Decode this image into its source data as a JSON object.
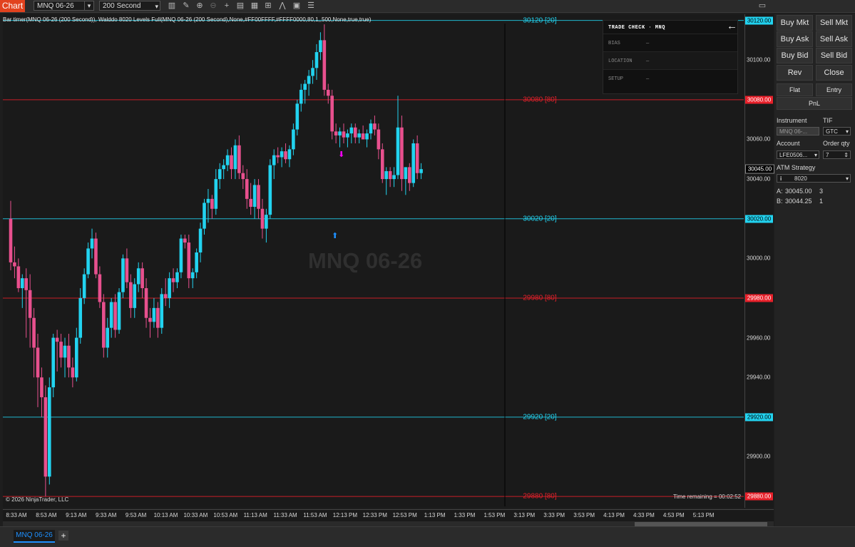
{
  "toolbar": {
    "chart_label": "Chart",
    "instrument": "MNQ 06-26",
    "period": "200 Second",
    "icons": [
      "bar-type-icon",
      "draw-pencil-icon",
      "zoom-in-icon",
      "zoom-out-icon",
      "crosshair-icon",
      "data-box-icon",
      "properties-icon",
      "strategies-icon",
      "indicators-icon",
      "templates-icon",
      "chart-trader-icon"
    ]
  },
  "chart": {
    "indicator_text": "Bar timer(MNQ 06-26 (200 Second)), Walddo 8020 Levels Full(MNQ 06-26 (200 Second),None,#FF00FFFF,#FFFF0000,80,1,,500,None,true,true)",
    "watermark": "MNQ 06-26",
    "copyright": "© 2026 NinjaTrader, LLC",
    "time_remaining": "Time remaining = 00:02:52",
    "up_color": "#22d3f0",
    "down_color": "#e8508e"
  },
  "trade_check": {
    "title": "TRADE CHECK  ·  MNQ",
    "rows": [
      {
        "label": "BIAS",
        "value": "—"
      },
      {
        "label": "LOCATION",
        "value": "—"
      },
      {
        "label": "SETUP",
        "value": "—"
      }
    ]
  },
  "levels": [
    {
      "price": 30120,
      "text": "30120 [20]",
      "badge": "30120.00",
      "color": "#22d3f0"
    },
    {
      "price": 30080,
      "text": "30080 [80]",
      "badge": "30080.00",
      "color": "#e8202a"
    },
    {
      "price": 30020,
      "text": "30020 [20]",
      "badge": "30020.00",
      "color": "#22d3f0"
    },
    {
      "price": 29980,
      "text": "29980 [80]",
      "badge": "29980.00",
      "color": "#e8202a"
    },
    {
      "price": 29920,
      "text": "29920 [20]",
      "badge": "29920.00",
      "color": "#22d3f0"
    },
    {
      "price": 29880,
      "text": "29880 [80]",
      "badge": "29880.00",
      "color": "#e8202a"
    }
  ],
  "last_price_badge": "30045.00",
  "price_ticks": [
    "30100.00",
    "30060.00",
    "30040.00",
    "30000.00",
    "29960.00",
    "29940.00",
    "29900.00"
  ],
  "chart_data": {
    "type": "candlestick",
    "x_ticks": [
      "8:33 AM",
      "8:53 AM",
      "9:13 AM",
      "9:33 AM",
      "9:53 AM",
      "10:13 AM",
      "10:33 AM",
      "10:53 AM",
      "11:13 AM",
      "11:33 AM",
      "11:53 AM",
      "12:13 PM",
      "12:33 PM",
      "12:53 PM",
      "1:13 PM",
      "1:33 PM",
      "1:53 PM",
      "3:13 PM",
      "3:33 PM",
      "3:53 PM",
      "4:13 PM",
      "4:33 PM",
      "4:53 PM",
      "5:13 PM"
    ],
    "ylim": [
      29875,
      30122
    ],
    "y_ticks": [
      30100,
      30060,
      30040,
      30000,
      29960,
      29940,
      29900
    ],
    "last_price": 30045,
    "candles": [
      {
        "o": 30020,
        "h": 30029,
        "l": 29994,
        "c": 29998
      },
      {
        "o": 29998,
        "h": 30006,
        "l": 29990,
        "c": 29996
      },
      {
        "o": 29996,
        "h": 30000,
        "l": 29983,
        "c": 29985
      },
      {
        "o": 29985,
        "h": 29992,
        "l": 29975,
        "c": 29990
      },
      {
        "o": 29990,
        "h": 29995,
        "l": 29960,
        "c": 29984
      },
      {
        "o": 29984,
        "h": 29992,
        "l": 29955,
        "c": 29970
      },
      {
        "o": 29970,
        "h": 29975,
        "l": 29940,
        "c": 29955
      },
      {
        "o": 29955,
        "h": 29962,
        "l": 29925,
        "c": 29940
      },
      {
        "o": 29940,
        "h": 29945,
        "l": 29920,
        "c": 29930
      },
      {
        "o": 29930,
        "h": 29936,
        "l": 29880,
        "c": 29890
      },
      {
        "o": 29890,
        "h": 29940,
        "l": 29886,
        "c": 29935
      },
      {
        "o": 29935,
        "h": 29962,
        "l": 29930,
        "c": 29960
      },
      {
        "o": 29960,
        "h": 29964,
        "l": 29943,
        "c": 29958
      },
      {
        "o": 29958,
        "h": 29962,
        "l": 29945,
        "c": 29950
      },
      {
        "o": 29950,
        "h": 29960,
        "l": 29940,
        "c": 29956
      },
      {
        "o": 29956,
        "h": 29962,
        "l": 29940,
        "c": 29945
      },
      {
        "o": 29945,
        "h": 29950,
        "l": 29935,
        "c": 29940
      },
      {
        "o": 29940,
        "h": 29965,
        "l": 29938,
        "c": 29960
      },
      {
        "o": 29960,
        "h": 29985,
        "l": 29957,
        "c": 29980
      },
      {
        "o": 29980,
        "h": 29995,
        "l": 29977,
        "c": 29992
      },
      {
        "o": 29992,
        "h": 30008,
        "l": 29990,
        "c": 30005
      },
      {
        "o": 30005,
        "h": 30015,
        "l": 30000,
        "c": 30010
      },
      {
        "o": 30010,
        "h": 30013,
        "l": 29990,
        "c": 29992
      },
      {
        "o": 29992,
        "h": 29996,
        "l": 29975,
        "c": 29978
      },
      {
        "o": 29978,
        "h": 29982,
        "l": 29950,
        "c": 29955
      },
      {
        "o": 29955,
        "h": 29970,
        "l": 29950,
        "c": 29965
      },
      {
        "o": 29965,
        "h": 29980,
        "l": 29960,
        "c": 29978
      },
      {
        "o": 29978,
        "h": 29982,
        "l": 29960,
        "c": 29964
      },
      {
        "o": 29964,
        "h": 29985,
        "l": 29962,
        "c": 29983
      },
      {
        "o": 29983,
        "h": 30002,
        "l": 29980,
        "c": 30000
      },
      {
        "o": 30000,
        "h": 30005,
        "l": 29985,
        "c": 29988
      },
      {
        "o": 29988,
        "h": 29992,
        "l": 29970,
        "c": 29975
      },
      {
        "o": 29975,
        "h": 29990,
        "l": 29970,
        "c": 29987
      },
      {
        "o": 29987,
        "h": 29998,
        "l": 29983,
        "c": 29995
      },
      {
        "o": 29995,
        "h": 29998,
        "l": 29980,
        "c": 29985
      },
      {
        "o": 29985,
        "h": 29990,
        "l": 29965,
        "c": 29970
      },
      {
        "o": 29970,
        "h": 29975,
        "l": 29960,
        "c": 29968
      },
      {
        "o": 29968,
        "h": 29980,
        "l": 29965,
        "c": 29975
      },
      {
        "o": 29975,
        "h": 29978,
        "l": 29960,
        "c": 29965
      },
      {
        "o": 29965,
        "h": 29985,
        "l": 29962,
        "c": 29982
      },
      {
        "o": 29982,
        "h": 29990,
        "l": 29976,
        "c": 29980
      },
      {
        "o": 29980,
        "h": 29993,
        "l": 29975,
        "c": 29990
      },
      {
        "o": 29990,
        "h": 29995,
        "l": 29983,
        "c": 29988
      },
      {
        "o": 29988,
        "h": 29995,
        "l": 29985,
        "c": 29993
      },
      {
        "o": 29993,
        "h": 30012,
        "l": 29990,
        "c": 30010
      },
      {
        "o": 30010,
        "h": 30012,
        "l": 30005,
        "c": 30008
      },
      {
        "o": 30008,
        "h": 30012,
        "l": 29985,
        "c": 29990
      },
      {
        "o": 29990,
        "h": 29995,
        "l": 29985,
        "c": 29993
      },
      {
        "o": 29993,
        "h": 30005,
        "l": 29990,
        "c": 30003
      },
      {
        "o": 30003,
        "h": 30018,
        "l": 29998,
        "c": 30015
      },
      {
        "o": 30015,
        "h": 30030,
        "l": 30012,
        "c": 30028
      },
      {
        "o": 30028,
        "h": 30035,
        "l": 30018,
        "c": 30030
      },
      {
        "o": 30030,
        "h": 30032,
        "l": 30020,
        "c": 30025
      },
      {
        "o": 30025,
        "h": 30045,
        "l": 30022,
        "c": 30040
      },
      {
        "o": 30040,
        "h": 30048,
        "l": 30035,
        "c": 30045
      },
      {
        "o": 30045,
        "h": 30050,
        "l": 30040,
        "c": 30047
      },
      {
        "o": 30047,
        "h": 30055,
        "l": 30044,
        "c": 30052
      },
      {
        "o": 30052,
        "h": 30056,
        "l": 30040,
        "c": 30045
      },
      {
        "o": 30045,
        "h": 30060,
        "l": 30040,
        "c": 30057
      },
      {
        "o": 30057,
        "h": 30062,
        "l": 30040,
        "c": 30043
      },
      {
        "o": 30043,
        "h": 30047,
        "l": 30035,
        "c": 30040
      },
      {
        "o": 30040,
        "h": 30045,
        "l": 30025,
        "c": 30030
      },
      {
        "o": 30030,
        "h": 30038,
        "l": 30022,
        "c": 30026
      },
      {
        "o": 30026,
        "h": 30040,
        "l": 30020,
        "c": 30037
      },
      {
        "o": 30037,
        "h": 30040,
        "l": 30020,
        "c": 30025
      },
      {
        "o": 30025,
        "h": 30030,
        "l": 30010,
        "c": 30015
      },
      {
        "o": 30015,
        "h": 30025,
        "l": 30008,
        "c": 30022
      },
      {
        "o": 30022,
        "h": 30050,
        "l": 30020,
        "c": 30047
      },
      {
        "o": 30047,
        "h": 30055,
        "l": 30040,
        "c": 30052
      },
      {
        "o": 30052,
        "h": 30056,
        "l": 30048,
        "c": 30051
      },
      {
        "o": 30051,
        "h": 30056,
        "l": 30046,
        "c": 30054
      },
      {
        "o": 30054,
        "h": 30058,
        "l": 30048,
        "c": 30050
      },
      {
        "o": 30050,
        "h": 30057,
        "l": 30046,
        "c": 30055
      },
      {
        "o": 30055,
        "h": 30068,
        "l": 30052,
        "c": 30065
      },
      {
        "o": 30065,
        "h": 30080,
        "l": 30062,
        "c": 30078
      },
      {
        "o": 30078,
        "h": 30088,
        "l": 30074,
        "c": 30085
      },
      {
        "o": 30085,
        "h": 30090,
        "l": 30078,
        "c": 30088
      },
      {
        "o": 30088,
        "h": 30095,
        "l": 30082,
        "c": 30092
      },
      {
        "o": 30092,
        "h": 30100,
        "l": 30088,
        "c": 30096
      },
      {
        "o": 30096,
        "h": 30108,
        "l": 30090,
        "c": 30104
      },
      {
        "o": 30104,
        "h": 30114,
        "l": 30100,
        "c": 30110
      },
      {
        "o": 30110,
        "h": 30118,
        "l": 30082,
        "c": 30085
      },
      {
        "o": 30085,
        "h": 30088,
        "l": 30078,
        "c": 30082
      },
      {
        "o": 30082,
        "h": 30085,
        "l": 30060,
        "c": 30064
      },
      {
        "o": 30064,
        "h": 30068,
        "l": 30058,
        "c": 30062
      },
      {
        "o": 30062,
        "h": 30066,
        "l": 30056,
        "c": 30064
      },
      {
        "o": 30064,
        "h": 30068,
        "l": 30058,
        "c": 30061
      },
      {
        "o": 30061,
        "h": 30065,
        "l": 30056,
        "c": 30063
      },
      {
        "o": 30063,
        "h": 30068,
        "l": 30058,
        "c": 30066
      },
      {
        "o": 30066,
        "h": 30068,
        "l": 30058,
        "c": 30061
      },
      {
        "o": 30061,
        "h": 30065,
        "l": 30058,
        "c": 30063
      },
      {
        "o": 30063,
        "h": 30067,
        "l": 30060,
        "c": 30060
      },
      {
        "o": 30060,
        "h": 30065,
        "l": 30056,
        "c": 30063
      },
      {
        "o": 30063,
        "h": 30070,
        "l": 30060,
        "c": 30068
      },
      {
        "o": 30068,
        "h": 30072,
        "l": 30062,
        "c": 30065
      },
      {
        "o": 30065,
        "h": 30068,
        "l": 30050,
        "c": 30055
      },
      {
        "o": 30055,
        "h": 30058,
        "l": 30038,
        "c": 30040
      },
      {
        "o": 30040,
        "h": 30046,
        "l": 30032,
        "c": 30044
      },
      {
        "o": 30044,
        "h": 30046,
        "l": 30036,
        "c": 30040
      },
      {
        "o": 30040,
        "h": 30046,
        "l": 30036,
        "c": 30042
      },
      {
        "o": 30042,
        "h": 30082,
        "l": 30040,
        "c": 30066
      },
      {
        "o": 30066,
        "h": 30072,
        "l": 30034,
        "c": 30040
      },
      {
        "o": 30040,
        "h": 30046,
        "l": 30032,
        "c": 30046
      },
      {
        "o": 30046,
        "h": 30048,
        "l": 30034,
        "c": 30038
      },
      {
        "o": 30038,
        "h": 30060,
        "l": 30036,
        "c": 30058
      },
      {
        "o": 30058,
        "h": 30062,
        "l": 30040,
        "c": 30043
      },
      {
        "o": 30043,
        "h": 30048,
        "l": 30040,
        "c": 30045
      }
    ]
  },
  "sidebar": {
    "buy_mkt": "Buy Mkt",
    "sell_mkt": "Sell Mkt",
    "buy_ask": "Buy Ask",
    "sell_ask": "Sell Ask",
    "buy_bid": "Buy Bid",
    "sell_bid": "Sell Bid",
    "rev": "Rev",
    "close": "Close",
    "flat": "Flat",
    "entry": "Entry",
    "pnl": "PnL",
    "instrument_label": "Instrument",
    "tif_label": "TIF",
    "instrument_value": "MNQ 06-...",
    "tif_value": "GTC",
    "account_label": "Account",
    "order_qty_label": "Order qty",
    "account_value": "LFE0506...",
    "order_qty_value": "7",
    "atm_label": "ATM Strategy",
    "atm_value": "8020",
    "ask_label": "A:",
    "ask_price": "30045.00",
    "ask_size": "3",
    "bid_label": "B:",
    "bid_price": "30044.25",
    "bid_size": "1"
  },
  "bottom_tab": "MNQ 06-26"
}
